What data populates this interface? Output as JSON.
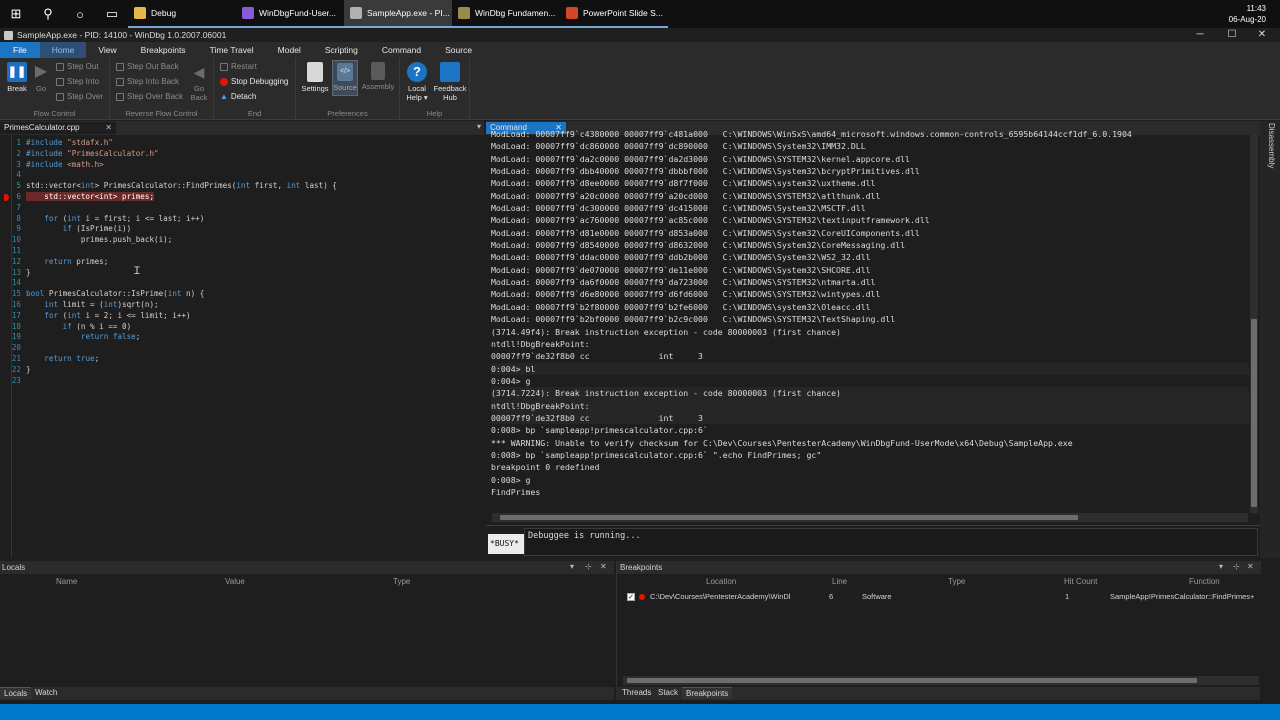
{
  "taskbar": {
    "apps": [
      {
        "label": "Debug",
        "color": "#e7b74a",
        "state": "open"
      },
      {
        "label": "WinDbgFund-User...",
        "color": "#8a5bd6",
        "state": "open"
      },
      {
        "label": "SampleApp.exe - PI...",
        "color": "#b0b0b0",
        "state": "active"
      },
      {
        "label": "WinDbg Fundamen...",
        "color": "#9c8a4a",
        "state": "open"
      },
      {
        "label": "PowerPoint Slide S...",
        "color": "#d24726",
        "state": "open"
      }
    ],
    "time": "11:43",
    "date": "06-Aug-20"
  },
  "window": {
    "title": "SampleApp.exe - PID: 14100 - WinDbg 1.0.2007.06001"
  },
  "ribbon": {
    "tabs": [
      "File",
      "Home",
      "View",
      "Breakpoints",
      "Time Travel",
      "Model",
      "Scripting",
      "Command",
      "Source"
    ],
    "groups": {
      "flow_control": "Flow Control",
      "reverse_flow": "Reverse Flow Control",
      "end": "End",
      "preferences": "Preferences",
      "help": "Help"
    },
    "buttons": {
      "break": "Break",
      "go": "Go",
      "step_out": "Step Out",
      "step_into": "Step Into",
      "step_over": "Step Over",
      "step_out_back": "Step Out Back",
      "step_into_back": "Step Into Back",
      "step_over_back": "Step Over Back",
      "go_back_1": "Go",
      "go_back_2": "Back",
      "restart": "Restart",
      "stop_debugging": "Stop Debugging",
      "detach": "Detach",
      "settings": "Settings",
      "source": "Source",
      "assembly": "Assembly",
      "local_help_1": "Local",
      "local_help_2": "Help ▾",
      "feedback_hub_1": "Feedback",
      "feedback_hub_2": "Hub"
    }
  },
  "source_pane": {
    "tab_label": "PrimesCalculator.cpp",
    "lines": [
      {
        "n": "1",
        "segments": [
          {
            "t": "#include ",
            "c": "kw"
          },
          {
            "t": "\"stdafx.h\"",
            "c": "str"
          }
        ]
      },
      {
        "n": "2",
        "segments": [
          {
            "t": "#include ",
            "c": "kw"
          },
          {
            "t": "\"PrimesCalculator.h\"",
            "c": "str"
          }
        ]
      },
      {
        "n": "3",
        "segments": [
          {
            "t": "#include ",
            "c": "kw"
          },
          {
            "t": "<math.h>",
            "c": "str"
          }
        ]
      },
      {
        "n": "4",
        "segments": []
      },
      {
        "n": "5",
        "segments": [
          {
            "t": "std::vector<",
            "c": ""
          },
          {
            "t": "int",
            "c": "kw"
          },
          {
            "t": "> PrimesCalculator::FindPrimes(",
            "c": ""
          },
          {
            "t": "int",
            "c": "kw"
          },
          {
            "t": " first, ",
            "c": ""
          },
          {
            "t": "int",
            "c": "kw"
          },
          {
            "t": " last) {",
            "c": ""
          }
        ]
      },
      {
        "n": "6",
        "breakpoint": true,
        "segments": [
          {
            "t": "    std::vector<int> primes;",
            "c": "bphl"
          }
        ]
      },
      {
        "n": "7",
        "segments": []
      },
      {
        "n": "8",
        "segments": [
          {
            "t": "    ",
            "c": ""
          },
          {
            "t": "for",
            "c": "kw"
          },
          {
            "t": " (",
            "c": ""
          },
          {
            "t": "int",
            "c": "kw"
          },
          {
            "t": " i = first; i <= last; i++)",
            "c": ""
          }
        ]
      },
      {
        "n": "9",
        "segments": [
          {
            "t": "        ",
            "c": ""
          },
          {
            "t": "if",
            "c": "kw"
          },
          {
            "t": " (IsPrime(i))",
            "c": ""
          }
        ]
      },
      {
        "n": "10",
        "segments": [
          {
            "t": "            primes.push_back(i);",
            "c": ""
          }
        ]
      },
      {
        "n": "11",
        "segments": []
      },
      {
        "n": "12",
        "segments": [
          {
            "t": "    ",
            "c": ""
          },
          {
            "t": "return",
            "c": "kw"
          },
          {
            "t": " primes;",
            "c": ""
          }
        ]
      },
      {
        "n": "13",
        "segments": [
          {
            "t": "}",
            "c": ""
          }
        ]
      },
      {
        "n": "14",
        "segments": []
      },
      {
        "n": "15",
        "segments": [
          {
            "t": "bool",
            "c": "kw"
          },
          {
            "t": " PrimesCalculator::IsPrime(",
            "c": ""
          },
          {
            "t": "int",
            "c": "kw"
          },
          {
            "t": " n) {",
            "c": ""
          }
        ]
      },
      {
        "n": "16",
        "segments": [
          {
            "t": "    ",
            "c": ""
          },
          {
            "t": "int",
            "c": "kw"
          },
          {
            "t": " limit = (",
            "c": ""
          },
          {
            "t": "int",
            "c": "kw"
          },
          {
            "t": ")sqrt(n);",
            "c": ""
          }
        ]
      },
      {
        "n": "17",
        "segments": [
          {
            "t": "    ",
            "c": ""
          },
          {
            "t": "for",
            "c": "kw"
          },
          {
            "t": " (",
            "c": ""
          },
          {
            "t": "int",
            "c": "kw"
          },
          {
            "t": " i = 2; i <= limit; i++)",
            "c": ""
          }
        ]
      },
      {
        "n": "18",
        "segments": [
          {
            "t": "        ",
            "c": ""
          },
          {
            "t": "if",
            "c": "kw"
          },
          {
            "t": " (n % i == 0)",
            "c": ""
          }
        ]
      },
      {
        "n": "19",
        "segments": [
          {
            "t": "            ",
            "c": ""
          },
          {
            "t": "return false",
            "c": "kw"
          },
          {
            "t": ";",
            "c": ""
          }
        ]
      },
      {
        "n": "20",
        "segments": []
      },
      {
        "n": "21",
        "segments": [
          {
            "t": "    ",
            "c": ""
          },
          {
            "t": "return true",
            "c": "kw"
          },
          {
            "t": ";",
            "c": ""
          }
        ]
      },
      {
        "n": "22",
        "segments": [
          {
            "t": "}",
            "c": ""
          }
        ]
      },
      {
        "n": "23",
        "segments": []
      }
    ]
  },
  "command_pane": {
    "tab_label": "Command",
    "lines": [
      {
        "t": "ModLoad: 00007ff9`c4380000 00007ff9`c481a000   C:\\WINDOWS\\WinSxS\\amd64_microsoft.windows.common-controls_6595b64144ccf1df_6.0.1904",
        "hl": false
      },
      {
        "t": "ModLoad: 00007ff9`dc860000 00007ff9`dc890000   C:\\WINDOWS\\System32\\IMM32.DLL",
        "hl": false
      },
      {
        "t": "ModLoad: 00007ff9`da2c0000 00007ff9`da2d3000   C:\\WINDOWS\\SYSTEM32\\kernel.appcore.dll",
        "hl": false
      },
      {
        "t": "ModLoad: 00007ff9`dbb40000 00007ff9`dbbbf000   C:\\WINDOWS\\System32\\bcryptPrimitives.dll",
        "hl": false
      },
      {
        "t": "ModLoad: 00007ff9`d8ee0000 00007ff9`d8f7f000   C:\\WINDOWS\\system32\\uxtheme.dll",
        "hl": false
      },
      {
        "t": "ModLoad: 00007ff9`a20c0000 00007ff9`a20cd000   C:\\WINDOWS\\SYSTEM32\\atlthunk.dll",
        "hl": false
      },
      {
        "t": "ModLoad: 00007ff9`dc300000 00007ff9`dc415000   C:\\WINDOWS\\System32\\MSCTF.dll",
        "hl": false
      },
      {
        "t": "ModLoad: 00007ff9`ac760000 00007ff9`ac85c000   C:\\WINDOWS\\SYSTEM32\\textinputframework.dll",
        "hl": false
      },
      {
        "t": "ModLoad: 00007ff9`d81e0000 00007ff9`d853a000   C:\\WINDOWS\\System32\\CoreUIComponents.dll",
        "hl": false
      },
      {
        "t": "ModLoad: 00007ff9`d8540000 00007ff9`d8632000   C:\\WINDOWS\\System32\\CoreMessaging.dll",
        "hl": false
      },
      {
        "t": "ModLoad: 00007ff9`ddac0000 00007ff9`ddb2b000   C:\\WINDOWS\\System32\\WS2_32.dll",
        "hl": false
      },
      {
        "t": "ModLoad: 00007ff9`de070000 00007ff9`de11e000   C:\\WINDOWS\\System32\\SHCORE.dll",
        "hl": false
      },
      {
        "t": "ModLoad: 00007ff9`da6f0000 00007ff9`da723000   C:\\WINDOWS\\SYSTEM32\\ntmarta.dll",
        "hl": false
      },
      {
        "t": "ModLoad: 00007ff9`d6e80000 00007ff9`d6fd6000   C:\\WINDOWS\\SYSTEM32\\wintypes.dll",
        "hl": false
      },
      {
        "t": "ModLoad: 00007ff9`b2f80000 00007ff9`b2fe6000   C:\\WINDOWS\\system32\\Oleacc.dll",
        "hl": false
      },
      {
        "t": "ModLoad: 00007ff9`b2bf0000 00007ff9`b2c9c000   C:\\WINDOWS\\SYSTEM32\\TextShaping.dll",
        "hl": false
      },
      {
        "t": "(3714.49f4): Break instruction exception - code 80000003 (first chance)",
        "hl": false
      },
      {
        "t": "ntdll!DbgBreakPoint:",
        "hl": false
      },
      {
        "t": "00007ff9`de32f8b0 cc              int     3",
        "hl": false
      },
      {
        "t": "0:004> bl",
        "hl": true
      },
      {
        "t": "0:004> g",
        "hl": false
      },
      {
        "t": "(3714.7224): Break instruction exception - code 80000003 (first chance)",
        "hl": true
      },
      {
        "t": "ntdll!DbgBreakPoint:",
        "hl": true
      },
      {
        "t": "00007ff9`de32f8b0 cc              int     3",
        "hl": true
      },
      {
        "t": "0:008> bp `sampleapp!primescalculator.cpp:6`",
        "hl": false
      },
      {
        "t": "*** WARNING: Unable to verify checksum for C:\\Dev\\Courses\\PentesterAcademy\\WinDbgFund-UserMode\\x64\\Debug\\SampleApp.exe",
        "hl": false
      },
      {
        "t": "0:008> bp `sampleapp!primescalculator.cpp:6` \".echo FindPrimes; gc\"",
        "hl": false
      },
      {
        "t": "breakpoint 0 redefined",
        "hl": false
      },
      {
        "t": "0:008> g",
        "hl": false
      },
      {
        "t": "FindPrimes",
        "hl": false
      }
    ],
    "prompt": "*BUSY*",
    "input_text": "Debuggee is running..."
  },
  "locals_pane": {
    "title": "Locals",
    "columns": [
      "Name",
      "Value",
      "Type"
    ],
    "tabs": [
      "Locals",
      "Watch"
    ]
  },
  "breakpoints_pane": {
    "title": "Breakpoints",
    "columns": [
      "Location",
      "Line",
      "Type",
      "Hit Count",
      "Function"
    ],
    "rows": [
      {
        "location": "C:\\Dev\\Courses\\PentesterAcademy\\WinDbgFun",
        "line": "6",
        "type": "Software",
        "hit_count": "1",
        "function": "SampleApp!PrimesCalculator::FindPrimes+"
      }
    ],
    "tabs": [
      "Threads",
      "Stack",
      "Breakpoints"
    ]
  },
  "side_tab": "Disassembly",
  "colors": {
    "accent": "#007acc",
    "file_tab": "#1c74c4",
    "breakpoint": "#e51400"
  }
}
